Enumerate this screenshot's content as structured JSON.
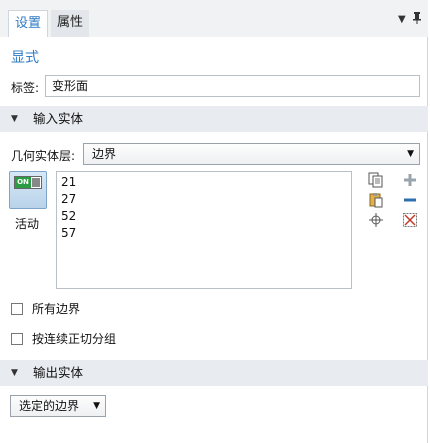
{
  "tabs": [
    {
      "label": "设置",
      "active": true
    },
    {
      "label": "属性",
      "active": false
    }
  ],
  "tab_controls": {
    "menu_icon": "dropdown-icon",
    "pin_icon": "pin-icon"
  },
  "title": "显式",
  "label_field": {
    "label": "标签:",
    "value": "变形面"
  },
  "input_section": {
    "title": "输入实体"
  },
  "geometry_level": {
    "label": "几何实体层:",
    "selected": "边界"
  },
  "active_toggle": {
    "state_text": "ON",
    "label": "活动"
  },
  "selection_list": [
    "21",
    "27",
    "52",
    "57"
  ],
  "side_icons": [
    "copy-icon",
    "paste-icon",
    "zoom-extents-icon",
    "add-icon",
    "remove-icon",
    "clear-selection-icon"
  ],
  "checkboxes": [
    {
      "label": "所有边界",
      "checked": false
    },
    {
      "label": "按连续正切分组",
      "checked": false
    }
  ],
  "output_section": {
    "title": "输出实体"
  },
  "output_select": {
    "selected": "选定的边界"
  },
  "colors": {
    "accent": "#2e7ac4",
    "section_bg": "#e8ecf0",
    "add": "#9aa4ad",
    "remove": "#2f6fb0"
  }
}
